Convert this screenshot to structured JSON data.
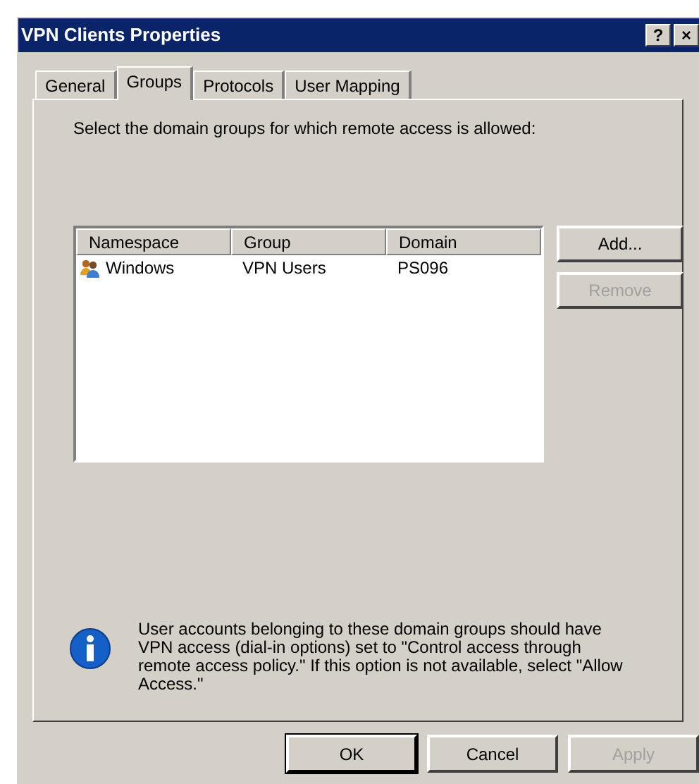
{
  "window": {
    "title": "VPN Clients Properties",
    "title_buttons": [
      "?",
      "×"
    ]
  },
  "tabs": [
    {
      "label": "General",
      "selected": false
    },
    {
      "label": "Groups",
      "selected": true
    },
    {
      "label": "Protocols",
      "selected": false
    },
    {
      "label": "User Mapping",
      "selected": false
    }
  ],
  "instruction": "Select the domain groups for which remote access is allowed:",
  "list": {
    "columns": [
      "Namespace",
      "Group",
      "Domain"
    ],
    "rows": [
      {
        "cells": [
          "Windows",
          "VPN Users",
          "PS096"
        ]
      }
    ]
  },
  "side_buttons": [
    {
      "label": "Add...",
      "disabled": false
    },
    {
      "label": "Remove",
      "disabled": true
    }
  ],
  "info": "User accounts belonging to these domain groups should have VPN access (dial-in options) set to \"Control access through remote access policy.\" If this option is not available, select \"Allow Access.\"",
  "buttons": [
    {
      "label": "OK",
      "default": true,
      "disabled": false
    },
    {
      "label": "Cancel",
      "default": false,
      "disabled": false
    },
    {
      "label": "Apply",
      "default": false,
      "disabled": true
    }
  ]
}
